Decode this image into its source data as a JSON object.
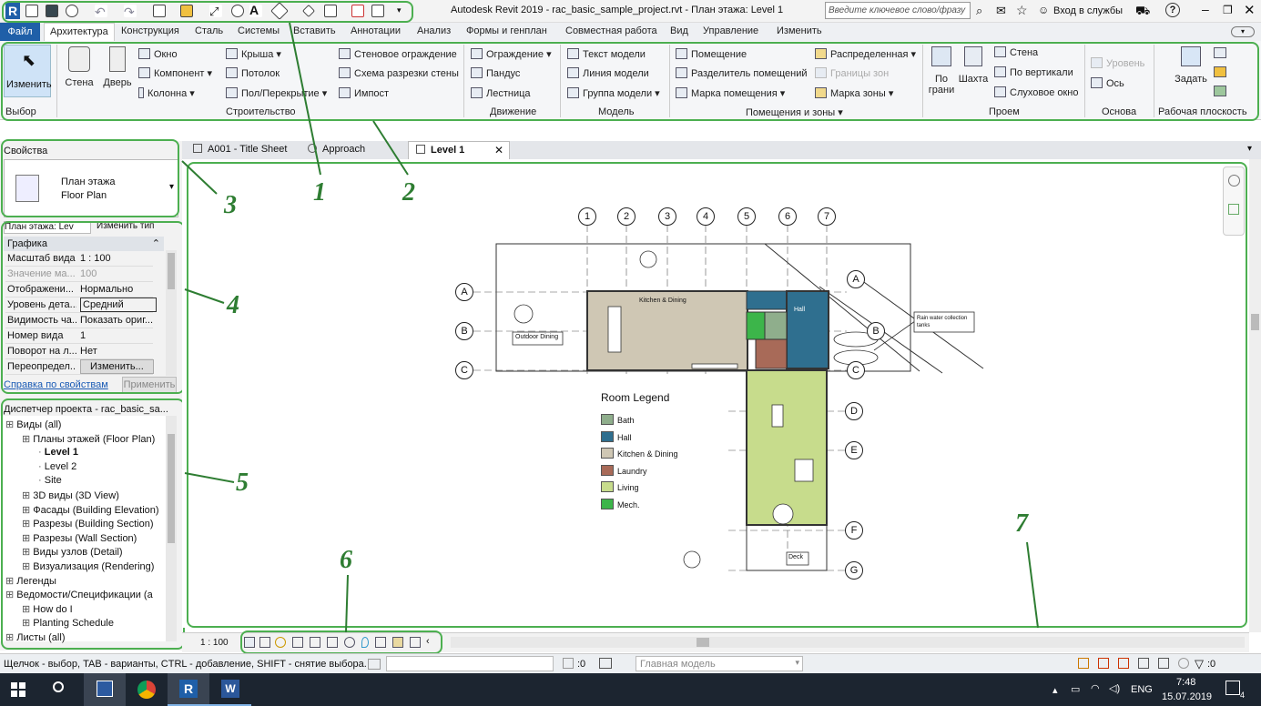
{
  "window": {
    "title": "Autodesk Revit 2019 - rac_basic_sample_project.rvt - План этажа: Level 1",
    "search_placeholder": "Введите ключевое слово/фразу",
    "signin": "Вход в службы",
    "help": "?"
  },
  "menu": {
    "file": "Файл",
    "tabs": [
      "Архитектура",
      "Конструкция",
      "Сталь",
      "Системы",
      "Вставить",
      "Аннотации",
      "Анализ",
      "Формы и генплан",
      "Совместная работа",
      "Вид",
      "Управление",
      "Изменить"
    ]
  },
  "ribbon": {
    "modify": "Изменить",
    "wall": "Стена",
    "door": "Дверь",
    "window": "Окно",
    "component": "Компонент",
    "column": "Колонна",
    "roof": "Крыша",
    "ceiling": "Потолок",
    "floor": "Пол/Перекрытие",
    "curtain_system": "Стеновое ограждение",
    "curtain_grid": "Схема разрезки стены",
    "mullion": "Импост",
    "railing": "Ограждение",
    "ramp": "Пандус",
    "stair": "Лестница",
    "model_text": "Текст модели",
    "model_line": "Линия модели",
    "model_group": "Группа модели",
    "room": "Помещение",
    "room_separator": "Разделитель помещений",
    "room_tag": "Марка помещения",
    "area": "Распределенная",
    "area_boundary": "Границы зон",
    "area_tag": "Марка зоны",
    "by_face": "По",
    "by_face2": "грани",
    "shaft": "Шахта",
    "op_wall": "Стена",
    "vertical": "По вертикали",
    "dormer": "Слуховое окно",
    "level": "Уровень",
    "grid": "Ось",
    "set": "Задать",
    "panels": {
      "select": "Выбор",
      "build": "Строительство",
      "circulation": "Движение",
      "model": "Модель",
      "room_area": "Помещения и зоны",
      "opening": "Проем",
      "datum": "Основа",
      "work_plane": "Рабочая плоскость"
    }
  },
  "view_tabs": [
    "A001 - Title Sheet",
    "Approach",
    "Level 1"
  ],
  "properties": {
    "header": "Свойства",
    "type_line1": "План этажа",
    "type_line2": "Floor Plan",
    "selector": "План этажа: Lev",
    "edit_type": "Изменить тип",
    "group": "Графика",
    "rows": [
      {
        "k": "Масштаб вида",
        "v": "1 : 100"
      },
      {
        "k": "Значение ма...",
        "v": "100"
      },
      {
        "k": "Отображени...",
        "v": "Нормально"
      },
      {
        "k": "Уровень дета...",
        "v": "Средний"
      },
      {
        "k": "Видимость ча...",
        "v": "Показать ориг..."
      },
      {
        "k": "Номер вида",
        "v": "1"
      },
      {
        "k": "Поворот на л...",
        "v": "Нет"
      },
      {
        "k": "Переопредел...",
        "v": "Изменить..."
      }
    ],
    "help_link": "Справка по свойствам",
    "apply": "Применить"
  },
  "browser": {
    "header": "Диспетчер проекта - rac_basic_sa...",
    "items": [
      {
        "t": "Виды (all)",
        "d": 0
      },
      {
        "t": "Планы этажей (Floor Plan)",
        "d": 1
      },
      {
        "t": "Level 1",
        "d": 2
      },
      {
        "t": "Level 2",
        "d": 2
      },
      {
        "t": "Site",
        "d": 2
      },
      {
        "t": "3D виды (3D View)",
        "d": 1
      },
      {
        "t": "Фасады (Building Elevation)",
        "d": 1
      },
      {
        "t": "Разрезы (Building Section)",
        "d": 1
      },
      {
        "t": "Разрезы (Wall Section)",
        "d": 1
      },
      {
        "t": "Виды узлов (Detail)",
        "d": 1
      },
      {
        "t": "Визуализация (Rendering)",
        "d": 1
      },
      {
        "t": "Легенды",
        "d": 0
      },
      {
        "t": "Ведомости/Спецификации (a",
        "d": 0
      },
      {
        "t": "How do I",
        "d": 1
      },
      {
        "t": "Planting Schedule",
        "d": 1
      },
      {
        "t": "Листы (all)",
        "d": 0
      }
    ]
  },
  "drawing": {
    "grid_cols": [
      "1",
      "2",
      "3",
      "4",
      "5",
      "6",
      "7"
    ],
    "grid_rows": [
      "A",
      "B",
      "C",
      "D",
      "E",
      "F",
      "G"
    ],
    "labels": {
      "kitchen": "Kitchen & Dining",
      "hall": "Hall",
      "outdoor": "Outdoor Dining",
      "rain": "Rain water collection tanks",
      "deck": "Deck",
      "legend_title": "Room Legend"
    },
    "legend": [
      {
        "name": "Bath",
        "color": "#8fae8c"
      },
      {
        "name": "Hall",
        "color": "#2f6f8f"
      },
      {
        "name": "Kitchen & Dining",
        "color": "#cfc7b4"
      },
      {
        "name": "Laundry",
        "color": "#a86a58"
      },
      {
        "name": "Living",
        "color": "#c7dc8c"
      },
      {
        "name": "Mech.",
        "color": "#3cb54a"
      }
    ]
  },
  "annotations": [
    "1",
    "2",
    "3",
    "4",
    "5",
    "6",
    "7"
  ],
  "view_control": {
    "scale": "1 : 100"
  },
  "status": {
    "hint": "Щелчок - выбор, TAB - варианты, CTRL - добавление, SHIFT - снятие выбора.",
    "zero": ":0",
    "model": "Главная модель"
  },
  "taskbar": {
    "lang": "ENG",
    "time": "7:48",
    "date": "15.07.2019",
    "notif": "4"
  }
}
